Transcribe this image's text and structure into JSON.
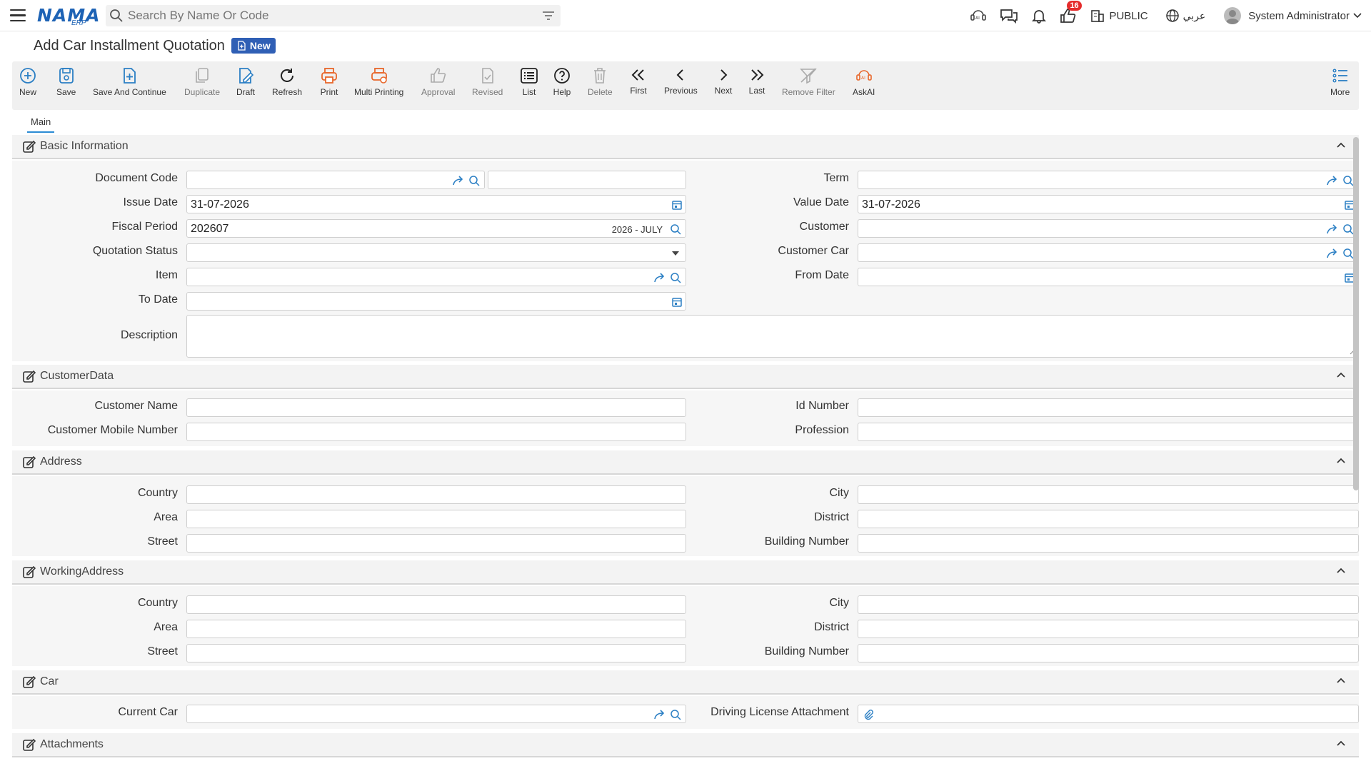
{
  "topbar": {
    "logo_main": "NAMA",
    "logo_sub": "ERP",
    "search_placeholder": "Search By Name Or Code",
    "notification_count": "16",
    "public_label": "PUBLIC",
    "language_label": "عربي",
    "user_name": "System Administrator"
  },
  "page": {
    "title": "Add Car Installment Quotation",
    "status_badge": "New"
  },
  "toolbar": [
    {
      "label": "New",
      "icon": "plus-circle-icon"
    },
    {
      "label": "Save",
      "icon": "save-icon"
    },
    {
      "label": "Save And Continue",
      "icon": "save-continue-icon"
    },
    {
      "label": "Duplicate",
      "icon": "duplicate-icon"
    },
    {
      "label": "Draft",
      "icon": "draft-icon"
    },
    {
      "label": "Refresh",
      "icon": "refresh-icon"
    },
    {
      "label": "Print",
      "icon": "print-icon"
    },
    {
      "label": "Multi Printing",
      "icon": "multi-print-icon"
    },
    {
      "label": "Approval",
      "icon": "thumbs-up-icon"
    },
    {
      "label": "Revised",
      "icon": "revised-icon"
    },
    {
      "label": "List",
      "icon": "list-icon"
    },
    {
      "label": "Help",
      "icon": "help-icon"
    },
    {
      "label": "Delete",
      "icon": "trash-icon"
    },
    {
      "label": "First",
      "icon": "double-chevron-left-icon"
    },
    {
      "label": "Previous",
      "icon": "chevron-left-icon"
    },
    {
      "label": "Next",
      "icon": "chevron-right-icon"
    },
    {
      "label": "Last",
      "icon": "double-chevron-right-icon"
    },
    {
      "label": "Remove Filter",
      "icon": "remove-filter-icon"
    },
    {
      "label": "AskAI",
      "icon": "ai-icon"
    },
    {
      "label": "More",
      "icon": "more-list-icon"
    }
  ],
  "tabs": [
    "Main"
  ],
  "sections": {
    "basic": {
      "title": "Basic Information",
      "document_code": "Document Code",
      "term": "Term",
      "issue_date": "Issue Date",
      "issue_date_value": "31-07-2026",
      "value_date": "Value Date",
      "value_date_value": "31-07-2026",
      "fiscal_period": "Fiscal Period",
      "fiscal_period_value": "202607",
      "fiscal_period_tag": "2026 - JULY",
      "customer": "Customer",
      "quotation_status": "Quotation Status",
      "customer_car": "Customer Car",
      "item": "Item",
      "from_date": "From Date",
      "to_date": "To Date",
      "description": "Description"
    },
    "customer_data": {
      "title": "CustomerData",
      "customer_name": "Customer Name",
      "id_number": "Id Number",
      "customer_mobile": "Customer Mobile Number",
      "profession": "Profession"
    },
    "address": {
      "title": "Address",
      "country": "Country",
      "city": "City",
      "area": "Area",
      "district": "District",
      "street": "Street",
      "building_number": "Building Number"
    },
    "working_address": {
      "title": "WorkingAddress",
      "country": "Country",
      "city": "City",
      "area": "Area",
      "district": "District",
      "street": "Street",
      "building_number": "Building Number"
    },
    "car": {
      "title": "Car",
      "current_car": "Current Car",
      "driving_license": "Driving License Attachment"
    },
    "attachments": {
      "title": "Attachments"
    }
  }
}
